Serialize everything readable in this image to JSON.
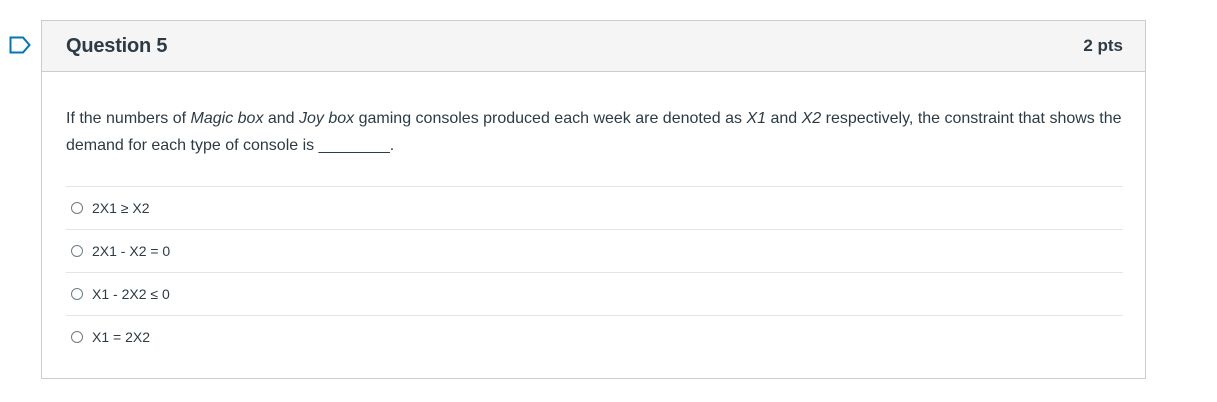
{
  "question": {
    "title": "Question 5",
    "points": "2 pts",
    "text_parts": [
      "If the numbers of ",
      "Magic box",
      " and ",
      "Joy box",
      " gaming consoles produced each week are denoted as ",
      "X1",
      " and ",
      "X2",
      " respectively, the constraint that shows the demand for each type of console is ________."
    ]
  },
  "answers": [
    {
      "label": "2X1 ≥ X2"
    },
    {
      "label": "2X1 - X2 = 0"
    },
    {
      "label": "X1 - 2X2 ≤ 0"
    },
    {
      "label": "X1 = 2X2"
    }
  ],
  "colors": {
    "header_bg": "#f5f5f5",
    "border": "#c7cdd1",
    "text": "#2d3b45",
    "flag": "#0374b5"
  }
}
